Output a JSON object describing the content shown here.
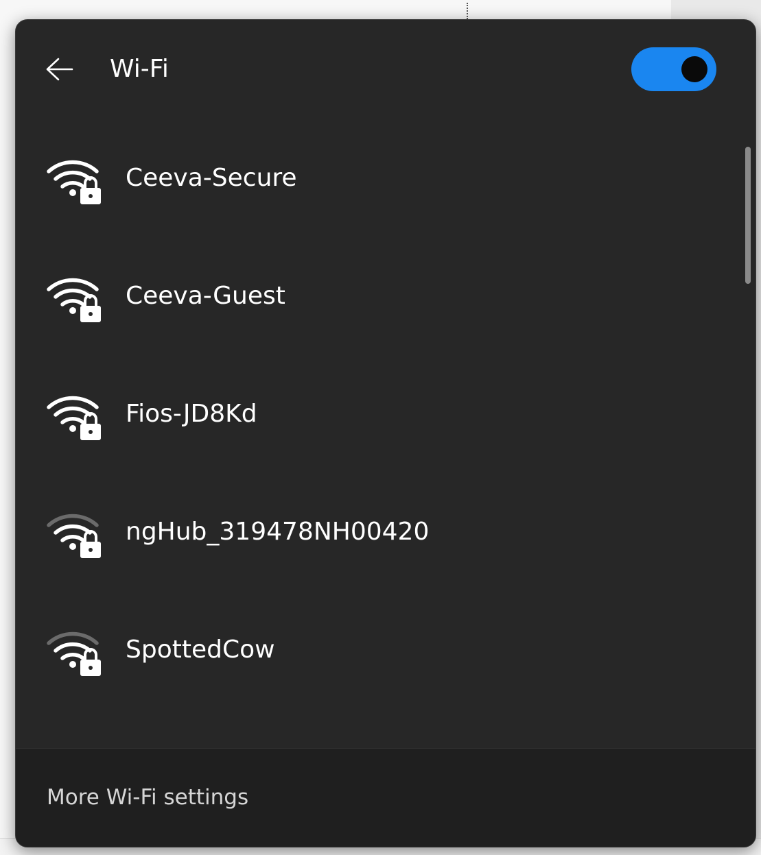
{
  "header": {
    "back_icon": "arrow-left-icon",
    "title": "Wi-Fi",
    "wifi_enabled": true
  },
  "networks": [
    {
      "name": "Ceeva-Secure",
      "signal_bars": 4,
      "secured": true
    },
    {
      "name": "Ceeva-Guest",
      "signal_bars": 4,
      "secured": true
    },
    {
      "name": "Fios-JD8Kd",
      "signal_bars": 4,
      "secured": true
    },
    {
      "name": "ngHub_319478NH00420",
      "signal_bars": 3,
      "secured": true
    },
    {
      "name": "SpottedCow",
      "signal_bars": 3,
      "secured": true
    }
  ],
  "footer": {
    "more_settings_label": "More Wi-Fi settings"
  },
  "colors": {
    "flyout_bg": "#272727",
    "footer_bg": "#1f1f1f",
    "accent": "#1a86f0",
    "text_primary": "#ffffff",
    "text_secondary": "#d6d6d6",
    "signal_dim": "#6b6b6b"
  }
}
